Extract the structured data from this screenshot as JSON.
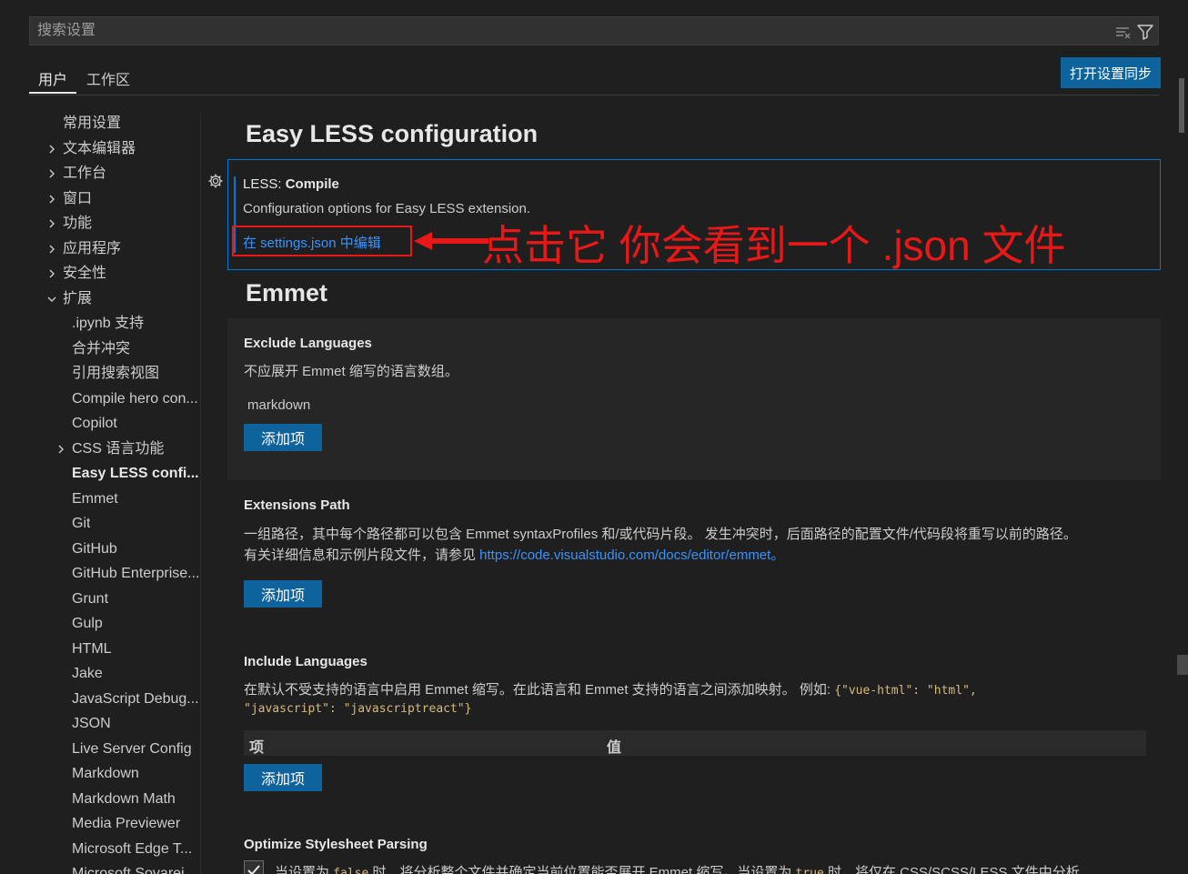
{
  "search": {
    "placeholder": "搜索设置"
  },
  "tabs": [
    {
      "label": "用户"
    },
    {
      "label": "工作区"
    }
  ],
  "sync_button": "打开设置同步",
  "toc": [
    {
      "label": "常用设置",
      "chevron": "none"
    },
    {
      "label": "文本编辑器",
      "chevron": "right"
    },
    {
      "label": "工作台",
      "chevron": "right"
    },
    {
      "label": "窗口",
      "chevron": "right"
    },
    {
      "label": "功能",
      "chevron": "right"
    },
    {
      "label": "应用程序",
      "chevron": "right"
    },
    {
      "label": "安全性",
      "chevron": "right"
    },
    {
      "label": "扩展",
      "chevron": "down"
    },
    {
      "label": ".ipynb 支持",
      "chevron": "none"
    },
    {
      "label": "合并冲突",
      "chevron": "none"
    },
    {
      "label": "引用搜索视图",
      "chevron": "none"
    },
    {
      "label": "Compile hero con...",
      "chevron": "none"
    },
    {
      "label": "Copilot",
      "chevron": "none"
    },
    {
      "label": "CSS 语言功能",
      "chevron": "right"
    },
    {
      "label": "Easy LESS confi...",
      "chevron": "none"
    },
    {
      "label": "Emmet",
      "chevron": "none"
    },
    {
      "label": "Git",
      "chevron": "none"
    },
    {
      "label": "GitHub",
      "chevron": "none"
    },
    {
      "label": "GitHub Enterprise...",
      "chevron": "none"
    },
    {
      "label": "Grunt",
      "chevron": "none"
    },
    {
      "label": "Gulp",
      "chevron": "none"
    },
    {
      "label": "HTML",
      "chevron": "none"
    },
    {
      "label": "Jake",
      "chevron": "none"
    },
    {
      "label": "JavaScript Debug...",
      "chevron": "none"
    },
    {
      "label": "JSON",
      "chevron": "none"
    },
    {
      "label": "Live Server Config",
      "chevron": "none"
    },
    {
      "label": "Markdown",
      "chevron": "none"
    },
    {
      "label": "Markdown Math",
      "chevron": "none"
    },
    {
      "label": "Media Previewer",
      "chevron": "none"
    },
    {
      "label": "Microsoft Edge T...",
      "chevron": "none"
    },
    {
      "label": "Microsoft Sovarei...",
      "chevron": "none"
    }
  ],
  "content": {
    "easyless": {
      "heading": "Easy LESS configuration",
      "title_prefix": "LESS: ",
      "title": "Compile",
      "desc": "Configuration options for Easy LESS extension.",
      "edit_link": "在 settings.json 中编辑",
      "annotation": "点击它 你会看到一个 .json 文件"
    },
    "emmet": {
      "heading": "Emmet",
      "exclude": {
        "title": "Exclude Languages",
        "desc": "不应展开 Emmet 缩写的语言数组。",
        "items": [
          "markdown"
        ],
        "button": "添加项"
      },
      "ext_path": {
        "title": "Extensions Path",
        "desc1": "一组路径，其中每个路径都可以包含 Emmet syntaxProfiles 和/或代码片段。 发生冲突时，后面路径的配置文件/代码段将重写以前的路径。",
        "desc2_prefix": "有关详细信息和示例片段文件，请参见 ",
        "desc2_link": "https://code.visualstudio.com/docs/editor/emmet",
        "desc2_suffix": "。",
        "button": "添加项"
      },
      "include": {
        "title": "Include Languages",
        "desc_prefix": "在默认不受支持的语言中启用 Emmet 缩写。在此语言和 Emmet 支持的语言之间添加映射。 例如: ",
        "code1": "{\"vue-html\": \"html\",",
        "code2": "\"javascript\": \"javascriptreact\"}",
        "col_item": "项",
        "col_value": "值",
        "button": "添加项"
      },
      "optimize": {
        "title": "Optimize Stylesheet Parsing",
        "desc_1": "当设置为 ",
        "code_false": "false",
        "desc_2": " 时，将分析整个文件并确定当前位置能否展开 Emmet 缩写。当设置为 ",
        "code_true": "true",
        "desc_3": " 时，将仅在 CSS/SCSS/LESS 文件中分析",
        "checked": true
      }
    }
  },
  "colors": {
    "background": "#1f1f1f",
    "accent": "#0e639c",
    "link": "#3794ff",
    "annotation_red": "#e81818",
    "focus_border": "#0078d4"
  }
}
